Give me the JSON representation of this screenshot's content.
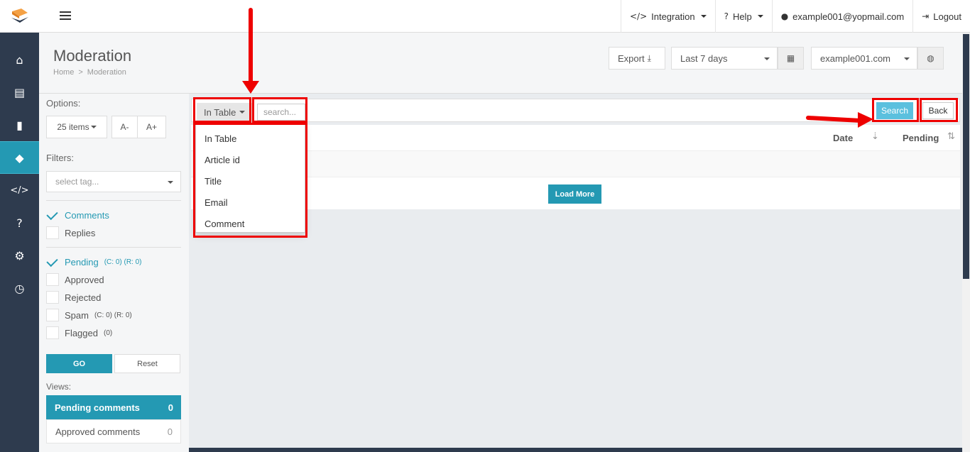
{
  "topbar": {
    "integration": "Integration",
    "help": "Help",
    "user": "example001@yopmail.com",
    "logout": "Logout"
  },
  "page": {
    "title": "Moderation",
    "breadcrumb_home": "Home",
    "breadcrumb_sep": ">",
    "breadcrumb_current": "Moderation",
    "export_label": "Export",
    "date_range": "Last 7 days",
    "site": "example001.com"
  },
  "options": {
    "label": "Options:",
    "items_per_page": "25 items",
    "font_decrease": "A-",
    "font_increase": "A+",
    "filters_label": "Filters:",
    "tag_placeholder": "select tag...",
    "types": [
      {
        "label": "Comments",
        "checked": true
      },
      {
        "label": "Replies",
        "checked": false
      }
    ],
    "statuses": [
      {
        "label": "Pending",
        "counts": "(C: 0) (R: 0)",
        "checked": true
      },
      {
        "label": "Approved",
        "counts": "",
        "checked": false
      },
      {
        "label": "Rejected",
        "counts": "",
        "checked": false
      },
      {
        "label": "Spam",
        "counts": "(C: 0) (R: 0)",
        "checked": false
      },
      {
        "label": "Flagged",
        "counts": "(0)",
        "checked": false
      }
    ],
    "go_label": "GO",
    "reset_label": "Reset",
    "views_label": "Views:",
    "views": [
      {
        "label": "Pending comments",
        "count": "0"
      },
      {
        "label": "Approved comments",
        "count": "0"
      }
    ]
  },
  "search": {
    "scope_label": "In Table",
    "placeholder": "search...",
    "search_button": "Search",
    "back_button": "Back",
    "scope_options": [
      "In Table",
      "Article id",
      "Title",
      "Email",
      "Comment"
    ]
  },
  "table": {
    "columns": [
      "Date",
      "Pending"
    ],
    "load_more": "Load More"
  },
  "colors": {
    "accent": "#2499b3",
    "sidebar": "#2e3b4e",
    "annotation": "#ee0000"
  }
}
